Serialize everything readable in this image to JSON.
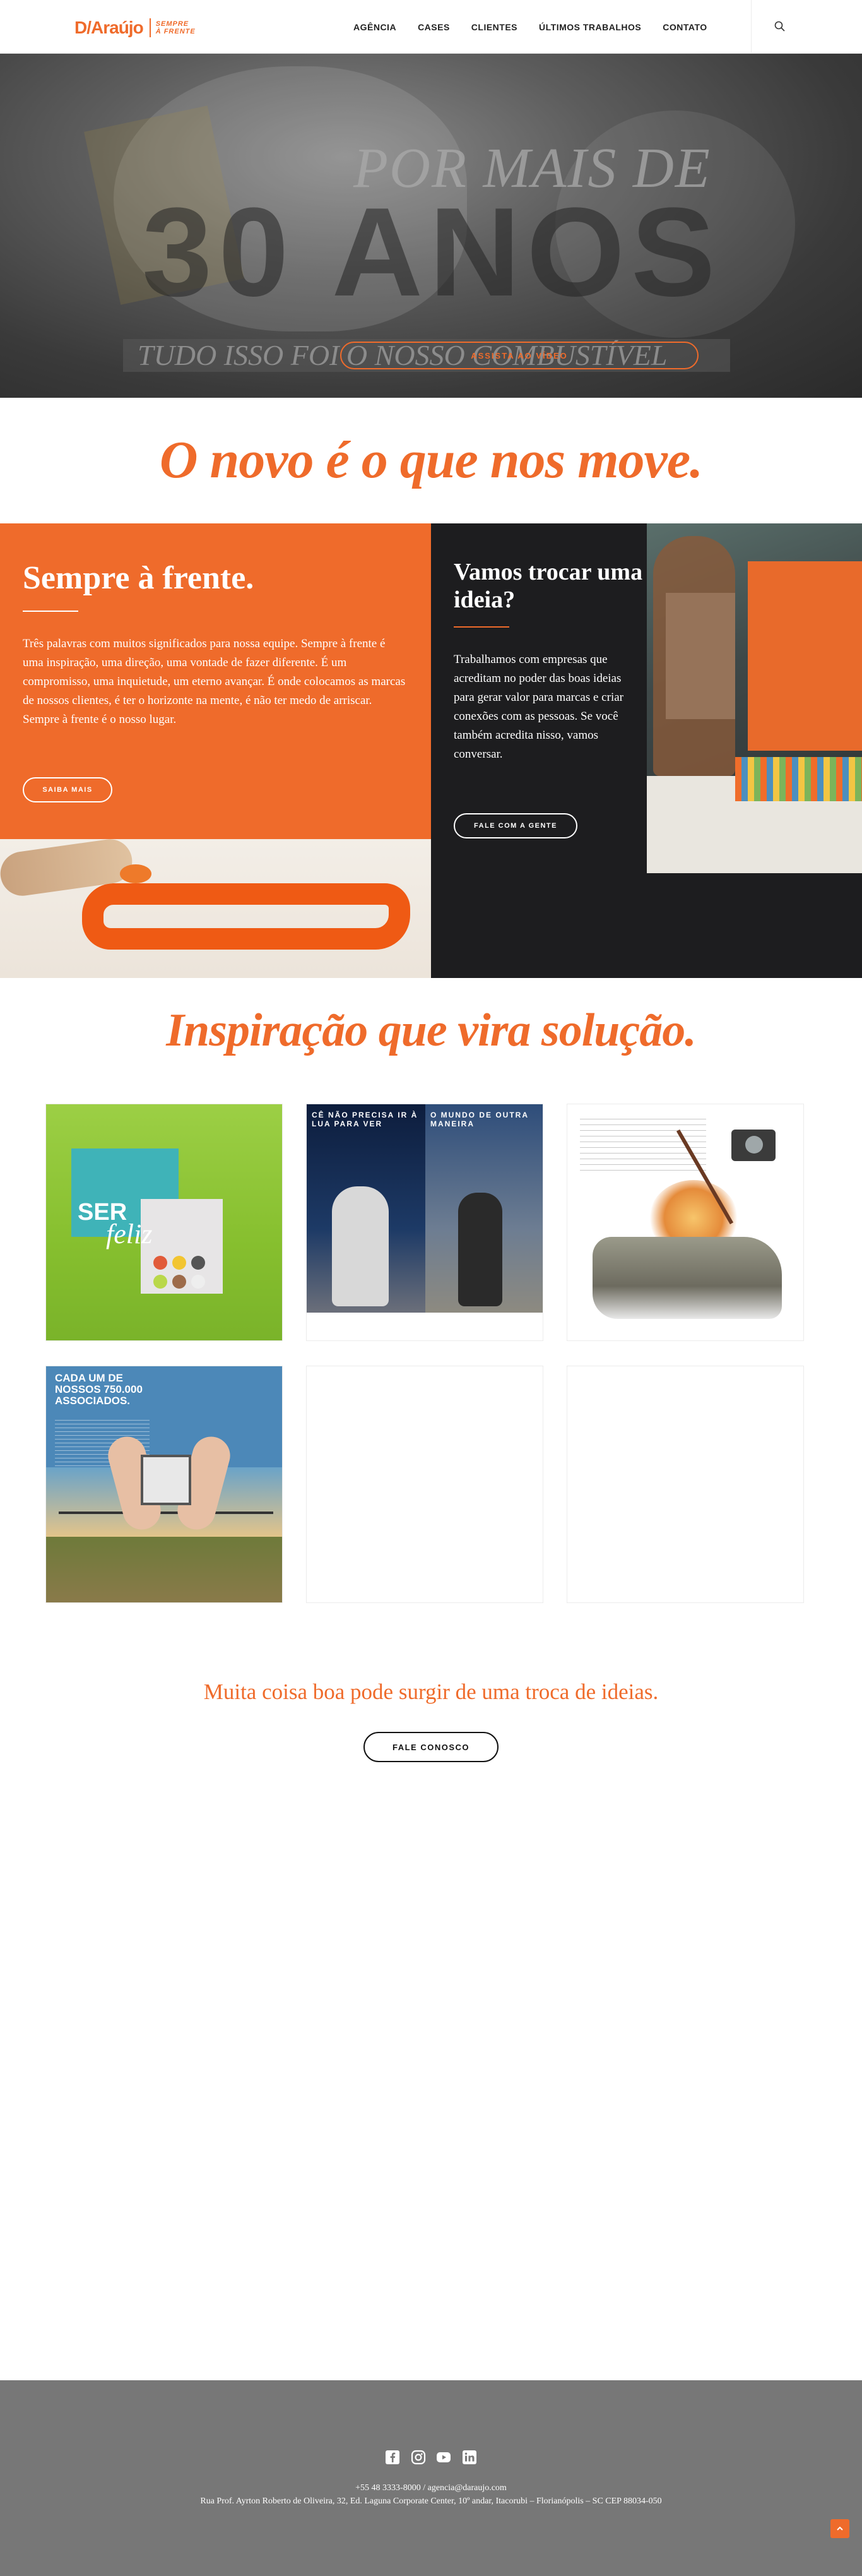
{
  "header": {
    "logo_main": "D/Araújo",
    "logo_tag_line1": "SEMPRE",
    "logo_tag_line2": "À FRENTE",
    "nav": [
      "AGÊNCIA",
      "CASES",
      "CLIENTES",
      "ÚLTIMOS TRABALHOS",
      "CONTATO"
    ],
    "search_icon": "search-icon"
  },
  "hero": {
    "line1": "POR MAIS DE",
    "line2": "30 ANOS",
    "line3": "TUDO ISSO FOI O NOSSO COMBUSTÍVEL",
    "video_button": "ASSISTA AO VÍDEO"
  },
  "slogan": "O novo é o que nos move.",
  "about": {
    "title": "Sempre à frente.",
    "text": "Três palavras com muitos significados para nossa equipe. Sempre à frente é uma inspiração, uma direção, uma vontade de fazer diferente. É um compromisso, uma inquietude, um eterno avançar. É onde colocamos as marcas de nossos clientes, é ter o horizonte na mente, é não ter medo de arriscar. Sempre à frente é o nosso lugar.",
    "button": "SAIBA MAIS"
  },
  "contact_block": {
    "title": "Vamos trocar uma ideia?",
    "text": "Trabalhamos com empresas que acreditam no poder das boas ideias para gerar valor para marcas e criar conexões com as pessoas. Se você também acredita nisso, vamos conversar.",
    "button": "FALE COM A GENTE"
  },
  "works": {
    "title": "Inspiração que vira solução.",
    "card1": {
      "ser": "SER",
      "feliz": "feliz"
    },
    "card2": {
      "head_left": "CÊ NÃO PRECISA IR À LUA PARA VER",
      "head_right": "O MUNDO DE OUTRA MANEIRA"
    },
    "card4": {
      "title": "CADA UM DE NOSSOS 750.000 ASSOCIADOS."
    }
  },
  "cta": {
    "text": "Muita coisa boa pode surgir de uma troca de ideias.",
    "button": "FALE CONOSCO"
  },
  "footer": {
    "socials": [
      "facebook-icon",
      "instagram-icon",
      "youtube-icon",
      "linkedin-icon"
    ],
    "contact": "+55 48 3333-8000 / agencia@daraujo.com",
    "address": "Rua Prof. Ayrton Roberto de Oliveira, 32, Ed. Laguna Corporate Center, 10º andar, Itacorubi – Florianópolis – SC CEP 88034-050"
  },
  "colors": {
    "accent": "#ef6b2b",
    "dark": "#1d1d1f",
    "footer": "#777777"
  }
}
